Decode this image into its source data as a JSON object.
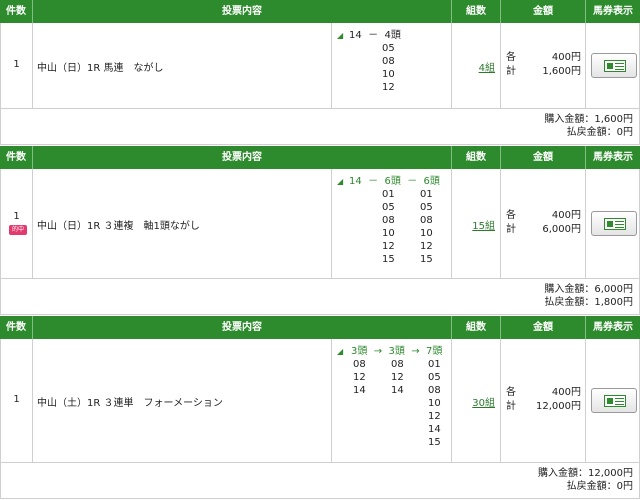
{
  "headers": {
    "count": "件数",
    "content": "投票内容",
    "combos": "組数",
    "amount": "金額",
    "ticket": "馬券表示"
  },
  "labels": {
    "each": "各",
    "total": "計",
    "purchase_prefix": "購入金額：",
    "refund_prefix": "払戻金額："
  },
  "bets": [
    {
      "count": "1",
      "badge": "",
      "description": "中山（日）1R 馬連　ながし",
      "combo_header": [
        "14",
        "－",
        "4頭"
      ],
      "col1": [],
      "col2": [
        "05",
        "08",
        "10",
        "12"
      ],
      "col3": [],
      "combos": "4組",
      "each": "400円",
      "total": "1,600円",
      "purchase": "1,600円",
      "refund": "0円"
    },
    {
      "count": "1",
      "badge": "的中",
      "description": "中山（日）1R ３連複　軸1頭ながし",
      "combo_header": [
        "14",
        "－",
        "6頭",
        "－",
        "6頭"
      ],
      "col1": [],
      "col2": [
        "01",
        "05",
        "08",
        "10",
        "12",
        "15"
      ],
      "col3": [
        "01",
        "05",
        "08",
        "10",
        "12",
        "15"
      ],
      "combos": "15組",
      "each": "400円",
      "total": "6,000円",
      "purchase": "6,000円",
      "refund": "1,800円"
    },
    {
      "count": "1",
      "badge": "",
      "description": "中山（土）1R ３連単　フォーメーション",
      "combo_header": [
        "3頭",
        "→",
        "3頭",
        "→",
        "7頭"
      ],
      "col1": [
        "08",
        "12",
        "14"
      ],
      "col2": [
        "08",
        "12",
        "14"
      ],
      "col3": [
        "01",
        "05",
        "08",
        "10",
        "12",
        "14",
        "15"
      ],
      "combos": "30組",
      "each": "400円",
      "total": "12,000円",
      "purchase": "12,000円",
      "refund": "0円"
    }
  ]
}
